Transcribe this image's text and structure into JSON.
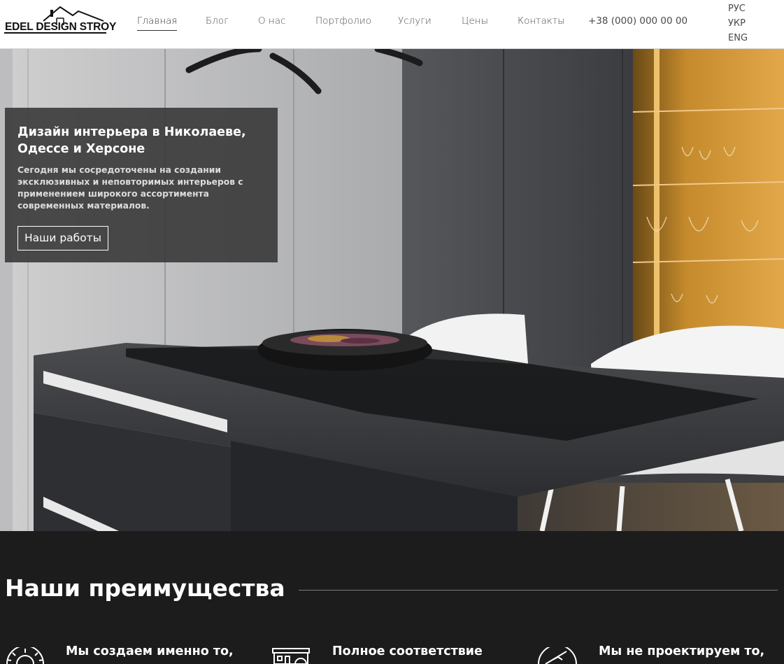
{
  "brand": {
    "logo_text": "EDEL DESIGN STROY"
  },
  "nav": {
    "items": [
      {
        "label": "Главная",
        "active": true
      },
      {
        "label": "Блог"
      },
      {
        "label": "О нас"
      },
      {
        "label": "Портфолио"
      },
      {
        "label": "Услуги"
      },
      {
        "label": "Цены"
      },
      {
        "label": "Контакты"
      }
    ],
    "phone": "+38 (000) 000 00 00",
    "languages": [
      "РУС",
      "УКР",
      "ENG"
    ]
  },
  "hero": {
    "title": "Дизайн интерьера в Николаеве, Одессе и Херсоне",
    "text": "Сегодня мы сосредоточены на создании эксклюзивных и неповторимых интерьеров с применением широкого ассортимента современных материалов.",
    "button_label": "Наши работы"
  },
  "advantages": {
    "title": "Наши преимущества",
    "items": [
      {
        "title": "Мы создаем именно то,",
        "icon": "gear-icon"
      },
      {
        "title": "Полное соответствие",
        "icon": "building-icon"
      },
      {
        "title": "Мы не проектируем то,",
        "icon": "forbidden-icon"
      }
    ]
  },
  "colors": {
    "header_bg": "#ffffff",
    "dark_section_bg": "#1d1c1c",
    "hero_overlay": "#323232",
    "accent_amber": "#d49a2a"
  }
}
